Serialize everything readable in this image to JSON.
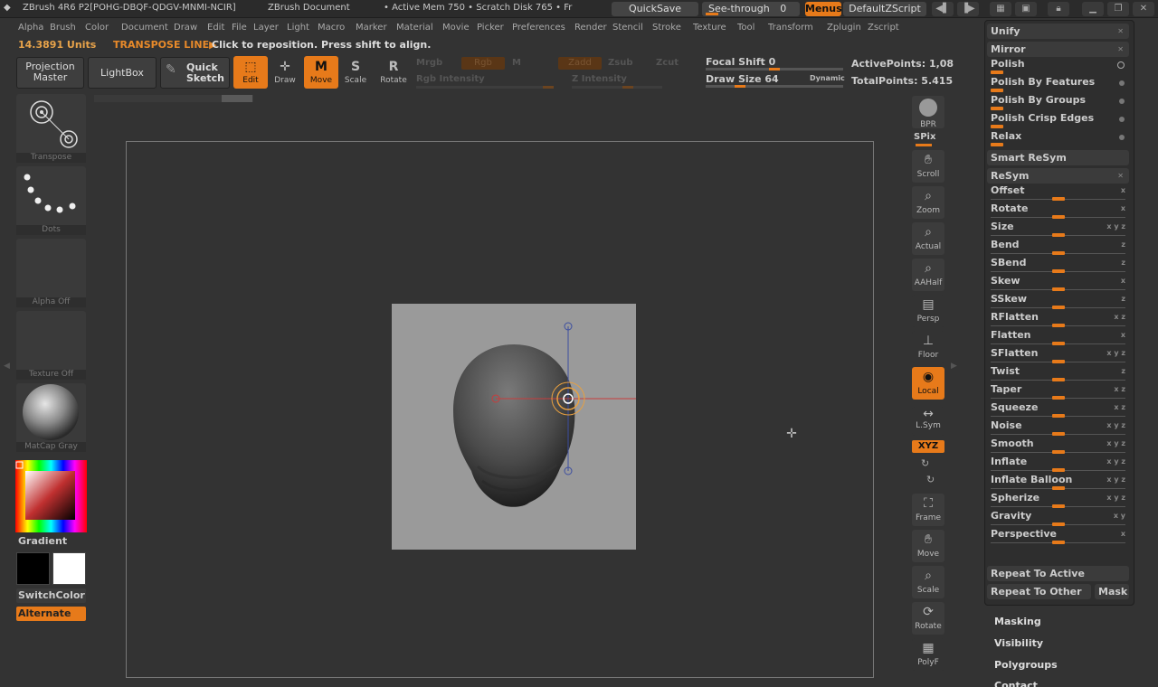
{
  "titlebar": {
    "app_title": "ZBrush 4R6 P2[POHG-DBQF-QDGV-MNMI-NCIR]",
    "document_title": "ZBrush Document",
    "mem_info": "• Active Mem 750 • Scratch Disk 765 • Fr",
    "quicksave_label": "QuickSave",
    "seethrough_label": "See-through",
    "seethrough_value": "0",
    "menus_label": "Menus",
    "defaultzscript_label": "DefaultZScript"
  },
  "menubar": {
    "items": [
      "Alpha",
      "Brush",
      "Color",
      "Document",
      "Draw",
      "Edit",
      "File",
      "Layer",
      "Light",
      "Macro",
      "Marker",
      "Material",
      "Movie",
      "Picker",
      "Preferences",
      "Render",
      "Stencil",
      "Stroke",
      "Texture",
      "Tool",
      "Transform",
      "Zplugin",
      "Zscript"
    ]
  },
  "status": {
    "units_value": "14.3891 Units",
    "mode_label": "TRANSPOSE LINE▶",
    "hint": "Click to reposition. Press shift to align."
  },
  "toolbar": {
    "projection_master_label": "Projection Master",
    "lightbox_label": "LightBox",
    "quick_sketch_label": "Quick Sketch",
    "edit_label": "Edit",
    "draw_label": "Draw",
    "move_label": "Move",
    "scale_label": "Scale",
    "rotate_label": "Rotate",
    "mrgb_label": "Mrgb",
    "rgb_label": "Rgb",
    "m_label": "M",
    "zadd_label": "Zadd",
    "zsub_label": "Zsub",
    "zcut_label": "Zcut",
    "rgb_intensity_label": "Rgb Intensity",
    "z_intensity_label": "Z Intensity",
    "focal_shift_label": "Focal Shift",
    "focal_shift_value": "0",
    "draw_size_label": "Draw Size",
    "draw_size_value": "64",
    "dynamic_label": "Dynamic",
    "active_points_label": "ActivePoints: 1,08",
    "total_points_label": "TotalPoints: 5.415"
  },
  "left_shelf": {
    "transpose_label": "Transpose",
    "dots_label": "Dots",
    "alpha_label": "Alpha Off",
    "texture_label": "Texture Off",
    "material_label": "MatCap Gray",
    "gradient_label": "Gradient",
    "switch_color_label": "SwitchColor",
    "alternate_label": "Alternate"
  },
  "right_shelf": {
    "bpr": "BPR",
    "spix": "SPix",
    "scroll": "Scroll",
    "zoom": "Zoom",
    "actual": "Actual",
    "aahalf": "AAHalf",
    "persp": "Persp",
    "floor": "Floor",
    "local": "Local",
    "lsym": "L.Sym",
    "xyz": "XYZ",
    "frame": "Frame",
    "move": "Move",
    "scale": "Scale",
    "rotate": "Rotate",
    "polyf": "PolyF"
  },
  "palette": {
    "unify": "Unify",
    "mirror": "Mirror",
    "polish": "Polish",
    "polish_by_features": "Polish By Features",
    "polish_by_groups": "Polish By Groups",
    "polish_crisp_edges": "Polish Crisp Edges",
    "relax": "Relax",
    "smart_resym": "Smart ReSym",
    "resym": "ReSym",
    "deformations": [
      {
        "label": "Offset",
        "axes": "x"
      },
      {
        "label": "Rotate",
        "axes": "x"
      },
      {
        "label": "Size",
        "axes": "x y z"
      },
      {
        "label": "Bend",
        "axes": "z"
      },
      {
        "label": "SBend",
        "axes": "z"
      },
      {
        "label": "Skew",
        "axes": "x"
      },
      {
        "label": "SSkew",
        "axes": "z"
      },
      {
        "label": "RFlatten",
        "axes": "x z"
      },
      {
        "label": "Flatten",
        "axes": "x"
      },
      {
        "label": "SFlatten",
        "axes": "x y z"
      },
      {
        "label": "Twist",
        "axes": "z"
      },
      {
        "label": "Taper",
        "axes": "x z"
      },
      {
        "label": "Squeeze",
        "axes": "x z"
      },
      {
        "label": "Noise",
        "axes": "x y z"
      },
      {
        "label": "Smooth",
        "axes": "x y z"
      },
      {
        "label": "Inflate",
        "axes": "x y z"
      },
      {
        "label": "Inflate Balloon",
        "axes": "x y z"
      },
      {
        "label": "Spherize",
        "axes": "x y z"
      },
      {
        "label": "Gravity",
        "axes": "x y"
      },
      {
        "label": "Perspective",
        "axes": "x"
      }
    ],
    "repeat_to_active": "Repeat To Active",
    "repeat_to_other": "Repeat To Other",
    "mask": "Mask",
    "sections": [
      "Masking",
      "Visibility",
      "Polygroups",
      "Contact"
    ]
  }
}
